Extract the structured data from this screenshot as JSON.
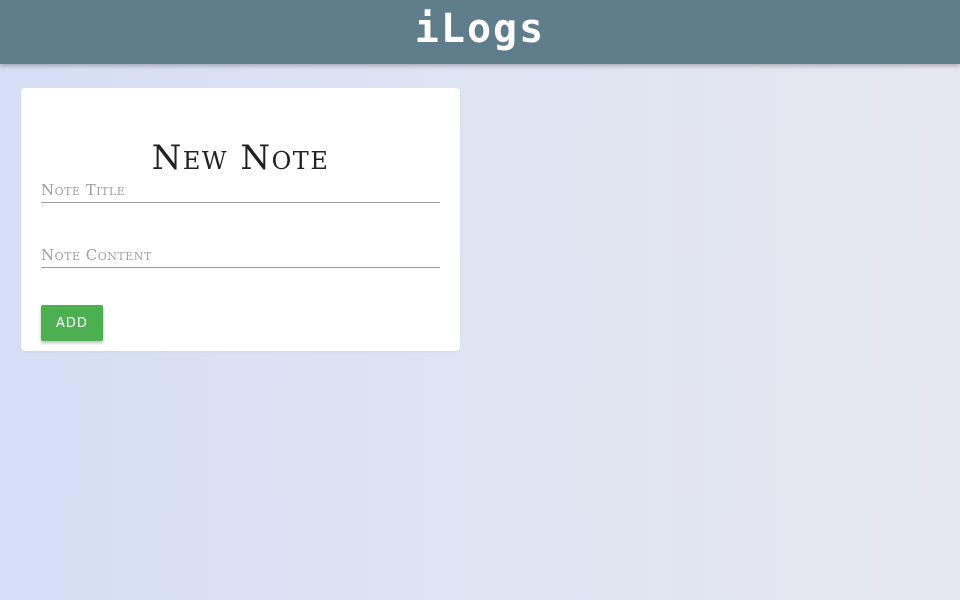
{
  "header": {
    "title": "iLogs",
    "background_color": "#607d8b"
  },
  "note_form": {
    "heading": "New Note",
    "title_field": {
      "placeholder": "Note Title",
      "value": ""
    },
    "content_field": {
      "placeholder": "Note Content",
      "value": ""
    },
    "add_label": "ADD",
    "add_color": "#4caf50"
  }
}
